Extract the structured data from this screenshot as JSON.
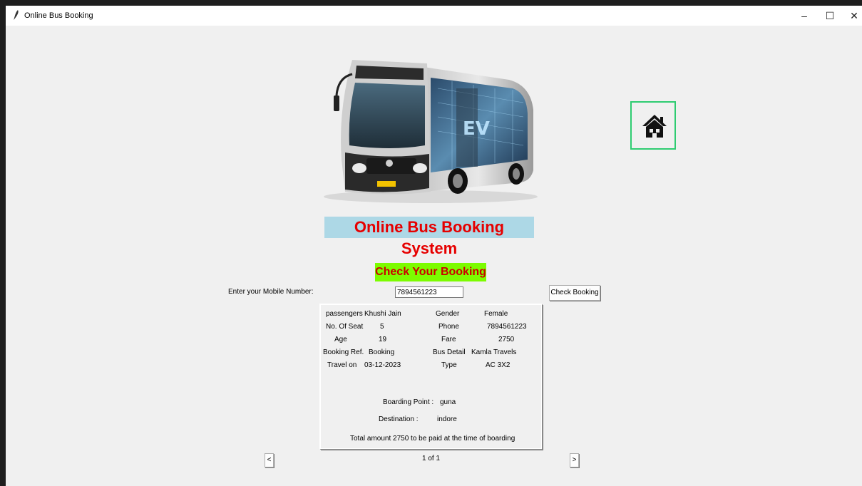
{
  "window": {
    "title": "Online Bus Booking",
    "minimize_label": "–",
    "maximize_label": "☐",
    "close_label": "✕"
  },
  "header": {
    "app_title": "Online Bus Booking System",
    "home_icon": "home-icon"
  },
  "booking_check": {
    "section_title": "Check Your Booking",
    "mobile_label": "Enter your Mobile Number:",
    "mobile_value": "7894561223",
    "check_button_label": "Check Booking"
  },
  "ticket": {
    "passengers_label": "passengers",
    "passengers_value": "Khushi Jain",
    "gender_label": "Gender",
    "gender_value": "Female",
    "seats_label": "No. Of Seat",
    "seats_value": "5",
    "phone_label": "Phone",
    "phone_value": "7894561223",
    "age_label": "Age",
    "age_value": "19",
    "fare_label": "Fare",
    "fare_value": "2750",
    "booking_ref_label": "Booking Ref.",
    "booking_ref_value": "Booking",
    "bus_detail_label": "Bus Detail",
    "bus_detail_value": "Kamla Travels",
    "travel_on_label": "Travel on",
    "travel_on_value": "03-12-2023",
    "type_label": "Type",
    "type_value": "AC 3X2",
    "boarding_label": "Boarding Point :",
    "boarding_value": "guna",
    "destination_label": "Destination :",
    "destination_value": "indore",
    "total_text": "Total amount 2750 to be paid at the time of boarding"
  },
  "pagination": {
    "prev_label": "<",
    "next_label": ">",
    "page_info": "1 of 1"
  },
  "bus_image_text": {
    "ev_badge": "EV"
  }
}
